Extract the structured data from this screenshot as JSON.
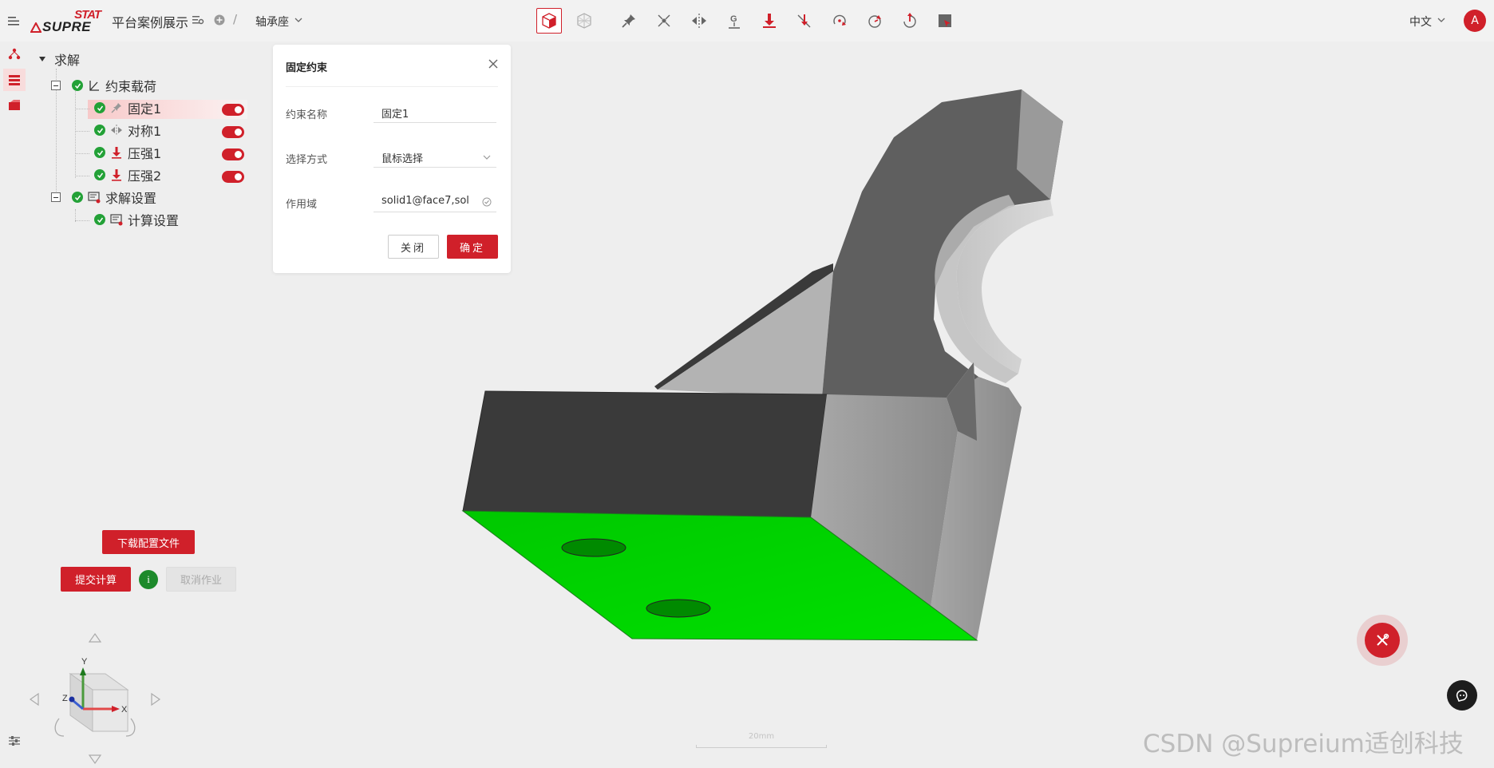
{
  "header": {
    "logo_top": "STAT",
    "logo_bottom": "SUPRE",
    "project_title": "平台案例展示",
    "breadcrumb_sep": "/",
    "model_name": "轴承座",
    "language": "中文",
    "avatar_letter": "A"
  },
  "toolbar": {
    "tools": [
      "solid-view-icon",
      "mesh-view-icon",
      "pin-constraint-icon",
      "symmetry-node-icon",
      "mirror-symmetry-icon",
      "gravity-icon",
      "pressure-load-icon",
      "force-icon",
      "moment-icon",
      "rotation-icon",
      "centrifugal-icon",
      "selection-box-icon"
    ],
    "active": "solid-view-icon"
  },
  "tree": {
    "root": "求解",
    "group1": "约束载荷",
    "items": [
      {
        "label": "固定1",
        "icon": "pin-icon",
        "enabled": true,
        "selected": true
      },
      {
        "label": "对称1",
        "icon": "symmetry-icon",
        "enabled": true,
        "selected": false
      },
      {
        "label": "压强1",
        "icon": "pressure-icon",
        "enabled": true,
        "selected": false
      },
      {
        "label": "压强2",
        "icon": "pressure-icon",
        "enabled": true,
        "selected": false
      }
    ],
    "group2": "求解设置",
    "group2_items": [
      {
        "label": "计算设置",
        "icon": "compute-settings-icon"
      }
    ]
  },
  "actions": {
    "download": "下载配置文件",
    "submit": "提交计算",
    "info": "i",
    "cancel": "取消作业"
  },
  "dialog": {
    "title": "固定约束",
    "name_label": "约束名称",
    "name_value": "固定1",
    "method_label": "选择方式",
    "method_value": "鼠标选择",
    "domain_label": "作用域",
    "domain_value": "solid1@face7,sol",
    "close_label": "关闭",
    "ok_label": "确定"
  },
  "viewport": {
    "scale_label": "20mm",
    "axis_x": "X",
    "axis_y": "Y",
    "axis_z": "Z",
    "selected_face_color": "#00d400",
    "body_color": "#8c8c8c"
  },
  "watermark": "CSDN @Supreium适创科技",
  "colors": {
    "accent": "#d0202a",
    "success": "#23a137"
  }
}
